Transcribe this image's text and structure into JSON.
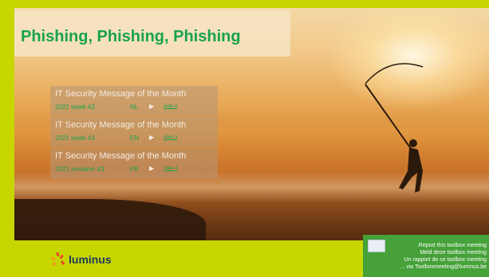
{
  "title": "Phishing, Phishing, Phishing",
  "messages": [
    {
      "heading": "IT Security Message of the Month",
      "week": "2021 week 43",
      "lang": "NL",
      "arrow": "▶",
      "link": "slide 2"
    },
    {
      "heading": "IT Security Message of the Month",
      "week": "2021 week 43",
      "lang": "EN",
      "arrow": "▶",
      "link": "slide 3"
    },
    {
      "heading": "IT Security Message of the Month",
      "week": "2021 semaine 43",
      "lang": "FR",
      "arrow": "▶",
      "link": "slide 4"
    }
  ],
  "logo": {
    "text": "luminus"
  },
  "report": {
    "lines": [
      "Report this toolbox meeting",
      "Meld deze toolbox meeting",
      "Un rapport de ce toolbox meeting",
      "... via Toolboxmeeting@luminus.be"
    ]
  },
  "colors": {
    "accent_green": "#17a34a",
    "frame": "#c8d600",
    "report_bg": "#45a138",
    "logo_navy": "#1b3a5c"
  }
}
